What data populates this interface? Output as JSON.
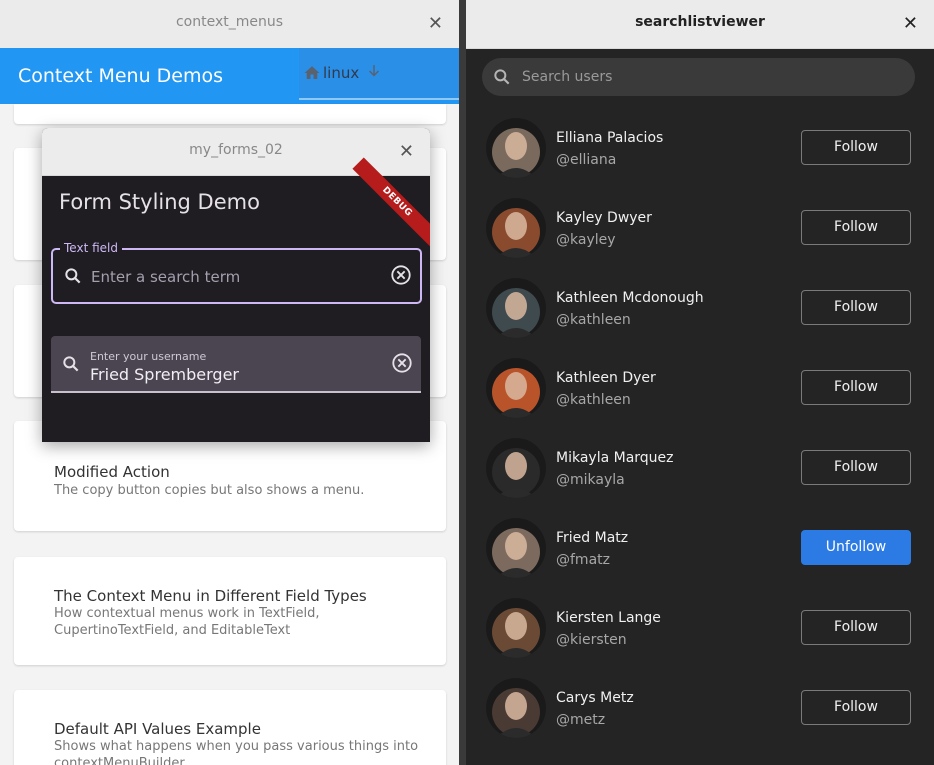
{
  "left_window": {
    "title": "context_menus",
    "appbar_title": "Context Menu Demos",
    "platform": {
      "label": "linux",
      "icon": "home-icon",
      "dropdown_icon": "arrow-down-icon"
    },
    "cards": [
      {
        "title": "Modified Action",
        "subtitle": "The copy button copies but also shows a menu."
      },
      {
        "title": "The Context Menu in Different Field Types",
        "subtitle": "How contextual menus work in TextField, CupertinoTextField, and EditableText"
      },
      {
        "title": "Default API Values Example",
        "subtitle": "Shows what happens when you pass various things into contextMenuBuilder."
      }
    ]
  },
  "forms_window": {
    "title": "my_forms_02",
    "heading": "Form Styling Demo",
    "debug_banner": "DEBUG",
    "text_field": {
      "label": "Text field",
      "placeholder": "Enter a search term"
    },
    "username_field": {
      "label": "Enter your username",
      "value": "Fried Spremberger"
    }
  },
  "right_window": {
    "title": "searchlistviewer",
    "search_placeholder": "Search users",
    "users": [
      {
        "name": "Elliana Palacios",
        "handle": "@elliana",
        "action": "Follow",
        "avatar_color": "#7a6a5e"
      },
      {
        "name": "Kayley Dwyer",
        "handle": "@kayley",
        "action": "Follow",
        "avatar_color": "#8a4a2e"
      },
      {
        "name": "Kathleen Mcdonough",
        "handle": "@kathleen",
        "action": "Follow",
        "avatar_color": "#3f4a4e"
      },
      {
        "name": "Kathleen Dyer",
        "handle": "@kathleen",
        "action": "Follow",
        "avatar_color": "#b8532a"
      },
      {
        "name": "Mikayla Marquez",
        "handle": "@mikayla",
        "action": "Follow",
        "avatar_color": "#2a2a2a"
      },
      {
        "name": "Fried Matz",
        "handle": "@fmatz",
        "action": "Unfollow",
        "avatar_color": "#7d6a5f"
      },
      {
        "name": "Kiersten Lange",
        "handle": "@kiersten",
        "action": "Follow",
        "avatar_color": "#6a4a35"
      },
      {
        "name": "Carys Metz",
        "handle": "@metz",
        "action": "Follow",
        "avatar_color": "#4a3a34"
      }
    ]
  },
  "colors": {
    "appbar_blue": "#2196f3",
    "unfollow_blue": "#2c7be5",
    "debug_red": "#b71c1c",
    "focus_purple": "#cdb8f5"
  }
}
